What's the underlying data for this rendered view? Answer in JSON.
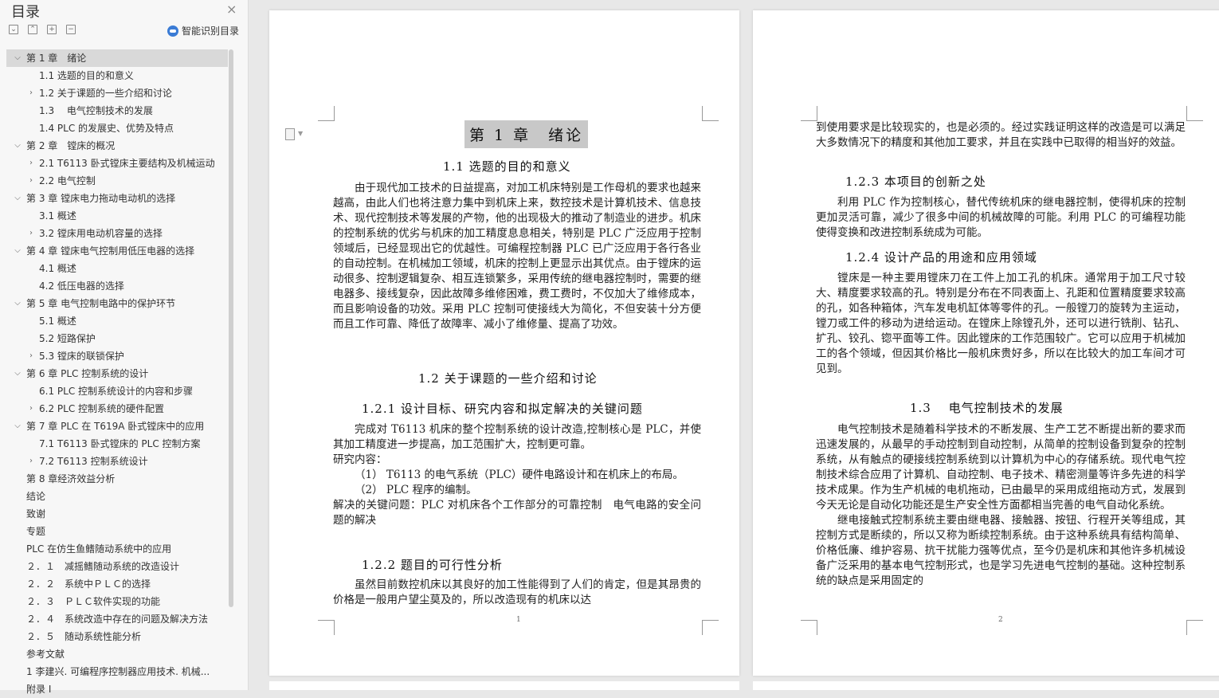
{
  "sidebar": {
    "title": "目录",
    "close": "×",
    "tools": [
      "⌄",
      "⌃",
      "+",
      "−"
    ],
    "smart_label": "智能识别目录",
    "items": [
      {
        "level": 1,
        "chev": "open",
        "label": "第 1 章　绪论",
        "selected": true
      },
      {
        "level": 2,
        "chev": "",
        "label": "1.1 选题的目的和意义"
      },
      {
        "level": 2,
        "chev": "closed",
        "label": "1.2 关于课题的一些介绍和讨论"
      },
      {
        "level": 2,
        "chev": "",
        "label": "1.3　 电气控制技术的发展"
      },
      {
        "level": 2,
        "chev": "",
        "label": "1.4 PLC 的发展史、优势及特点"
      },
      {
        "level": 1,
        "chev": "open",
        "label": "第 2 章　镗床的概况"
      },
      {
        "level": 2,
        "chev": "closed",
        "label": "2.1 T6113 卧式镗床主要结构及机械运动"
      },
      {
        "level": 2,
        "chev": "closed",
        "label": "2.2 电气控制"
      },
      {
        "level": 1,
        "chev": "open",
        "label": "第 3 章 镗床电力拖动电动机的选择"
      },
      {
        "level": 2,
        "chev": "",
        "label": "3.1 概述"
      },
      {
        "level": 2,
        "chev": "closed",
        "label": "3.2 镗床用电动机容量的选择"
      },
      {
        "level": 1,
        "chev": "open",
        "label": "第 4 章 镗床电气控制用低压电器的选择"
      },
      {
        "level": 2,
        "chev": "",
        "label": "4.1 概述"
      },
      {
        "level": 2,
        "chev": "",
        "label": "4.2 低压电器的选择"
      },
      {
        "level": 1,
        "chev": "open",
        "label": "第 5 章 电气控制电路中的保护环节"
      },
      {
        "level": 2,
        "chev": "",
        "label": "5.1 概述"
      },
      {
        "level": 2,
        "chev": "",
        "label": "5.2 短路保护"
      },
      {
        "level": 2,
        "chev": "closed",
        "label": "5.3 镗床的联锁保护"
      },
      {
        "level": 1,
        "chev": "open",
        "label": "第 6 章 PLC 控制系统的设计"
      },
      {
        "level": 2,
        "chev": "",
        "label": "6.1 PLC 控制系统设计的内容和步骤"
      },
      {
        "level": 2,
        "chev": "closed",
        "label": "6.2 PLC 控制系统的硬件配置"
      },
      {
        "level": 1,
        "chev": "open",
        "label": "第 7 章 PLC 在 T619A 卧式镗床中的应用"
      },
      {
        "level": 2,
        "chev": "",
        "label": "7.1 T6113 卧式镗床的 PLC 控制方案"
      },
      {
        "level": 2,
        "chev": "closed",
        "label": "7.2 T6113 控制系统设计"
      },
      {
        "level": 1,
        "chev": "",
        "label": "第 8 章经济效益分析"
      },
      {
        "level": 1,
        "chev": "",
        "label": "结论"
      },
      {
        "level": 1,
        "chev": "",
        "label": "致谢"
      },
      {
        "level": 1,
        "chev": "",
        "label": "专题"
      },
      {
        "level": 1,
        "chev": "",
        "label": "PLC 在仿生鱼鳍随动系统中的应用"
      },
      {
        "level": 1,
        "chev": "",
        "label": "２．１　减摇鳍随动系统的改造设计"
      },
      {
        "level": 1,
        "chev": "",
        "label": "２．２　系统中ＰＬＣ的选择"
      },
      {
        "level": 1,
        "chev": "",
        "label": "２．３　ＰＬＣ软件实现的功能"
      },
      {
        "level": 1,
        "chev": "",
        "label": "２．４　系统改造中存在的问题及解决方法"
      },
      {
        "level": 1,
        "chev": "",
        "label": "２．５　随动系统性能分析"
      },
      {
        "level": 1,
        "chev": "",
        "label": "参考文献"
      },
      {
        "level": 1,
        "chev": "",
        "label": "1 李建兴. 可编程序控制器应用技术. 机械..."
      },
      {
        "level": 1,
        "chev": "",
        "label": "附录 I"
      }
    ]
  },
  "page1": {
    "chapter_title": "第 1 章　绪论",
    "h_1_1": "1.1 选题的目的和意义",
    "p1": "由于现代加工技术的日益提高，对加工机床特别是工作母机的要求也越来越高，由此人们也将注意力集中到机床上来，数控技术是计算机技术、信息技术、现代控制技术等发展的产物，他的出现极大的推动了制造业的进步。机床的控制系统的优劣与机床的加工精度息息相关，特别是 PLC 广泛应用于控制领域后，已经显现出它的优越性。可编程控制器 PLC 已广泛应用于各行各业的自动控制。在机械加工领域，机床的控制上更显示出其优点。由于镗床的运动很多、控制逻辑复杂、相互连锁繁多，采用传统的继电器控制时，需要的继电器多、接线复杂，因此故障多维修困难，费工费时，不仅加大了维修成本，而且影响设备的功效。采用 PLC 控制可使接线大为简化，不但安装十分方便而且工作可靠、降低了故障率、减小了维修量、提高了功效。",
    "h_1_2": "1.2 关于课题的一些介绍和讨论",
    "h_1_2_1": "1.2.1 设计目标、研究内容和拟定解决的关键问题",
    "p2": "完成对 T6113 机床的整个控制系统的设计改造,控制核心是 PLC，并使其加工精度进一步提高，加工范围扩大，控制更可靠。",
    "p3": "研究内容：",
    "p4": "（1） T6113 的电气系统（PLC）硬件电路设计和在机床上的布局。",
    "p5": "（2） PLC 程序的编制。",
    "p6": "解决的关键问题：PLC 对机床各个工作部分的可靠控制　电气电路的安全问题的解决",
    "h_1_2_2": "1.2.2 题目的可行性分析",
    "p7": "虽然目前数控机床以其良好的加工性能得到了人们的肯定，但是其昂贵的价格是一般用户望尘莫及的，所以改造现有的机床以达",
    "page_number": "1"
  },
  "page2": {
    "p1": "到使用要求是比较现实的，也是必须的。经过实践证明这样的改造是可以满足大多数情况下的精度和其他加工要求，并且在实践中已取得的相当好的效益。",
    "h_1_2_3": "1.2.3 本项目的创新之处",
    "p2": "利用 PLC 作为控制核心，替代传统机床的继电器控制，使得机床的控制更加灵活可靠，减少了很多中间的机械故障的可能。利用 PLC 的可编程功能使得变换和改进控制系统成为可能。",
    "h_1_2_4": "1.2.4 设计产品的用途和应用领域",
    "p3": "镗床是一种主要用镗床刀在工件上加工孔的机床。通常用于加工尺寸较大、精度要求较高的孔。特别是分布在不同表面上、孔距和位置精度要求较高的孔，如各种箱体，汽车发电机缸体等零件的孔。一般镗刀的旋转为主运动，镗刀或工件的移动为进给运动。在镗床上除镗孔外，还可以进行铣削、钻孔、扩孔、铰孔、锪平面等工件。因此镗床的工作范围较广。它可以应用于机械加工的各个领域，但因其价格比一般机床贵好多，所以在比较大的加工车间才可见到。",
    "h_1_3": "1.3　 电气控制技术的发展",
    "p4": "电气控制技术是随着科学技术的不断发展、生产工艺不断提出新的要求而迅速发展的，从最早的手动控制到自动控制，从简单的控制设备到复杂的控制系统，从有触点的硬接线控制系统到以计算机为中心的存储系统。现代电气控制技术综合应用了计算机、自动控制、电子技术、精密测量等许多先进的科学技术成果。作为生产机械的电机拖动，已由最早的采用成组拖动方式，发展到今天无论是自动化功能还是生产安全性方面都相当完善的电气自动化系统。",
    "p5": "继电接触式控制系统主要由继电器、接触器、按钮、行程开关等组成，其控制方式是断续的，所以又称为断续控制系统。由于这种系统具有结构简单、价格低廉、维护容易、抗干扰能力强等优点，至今仍是机床和其他许多机械设备广泛采用的基本电气控制形式，也是学习先进电气控制的基础。这种控制系统的缺点是采用固定的",
    "page_number": "2"
  }
}
